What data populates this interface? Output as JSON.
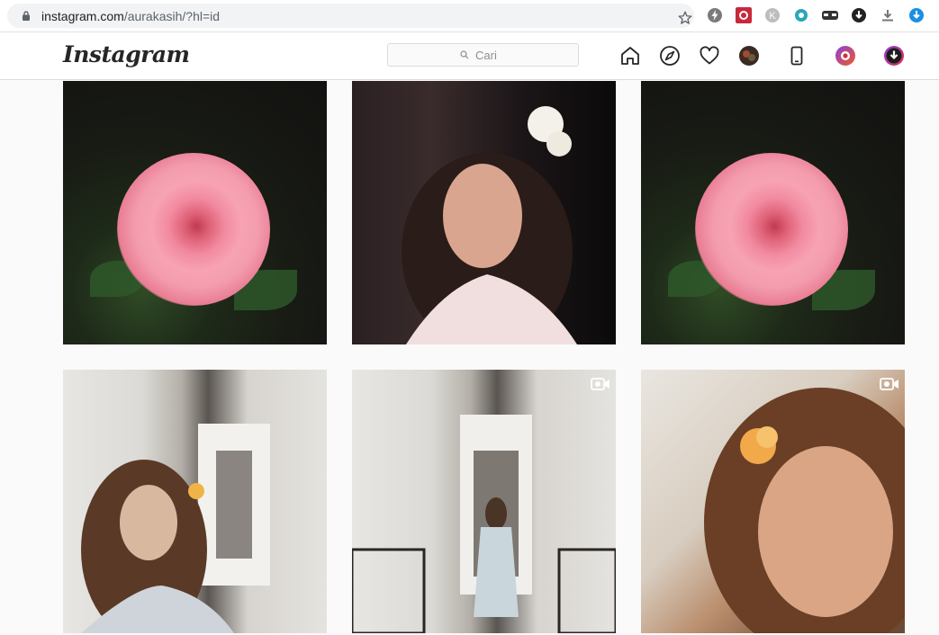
{
  "browser": {
    "url_host": "instagram.com",
    "url_path": "/aurakasih/?hl=id"
  },
  "header": {
    "logo": "Instagram",
    "search_placeholder": "Cari"
  },
  "posts": [
    {
      "alt": "pink rose",
      "video": false
    },
    {
      "alt": "woman with white flower in hair",
      "video": false
    },
    {
      "alt": "pink rose",
      "video": false
    },
    {
      "alt": "woman in corridor",
      "video": false
    },
    {
      "alt": "woman walking in corridor",
      "video": true
    },
    {
      "alt": "woman selfie with flower",
      "video": true
    }
  ],
  "colors": {
    "ig_text": "#262626",
    "border": "#dbdbdb",
    "background": "#fafafa"
  }
}
